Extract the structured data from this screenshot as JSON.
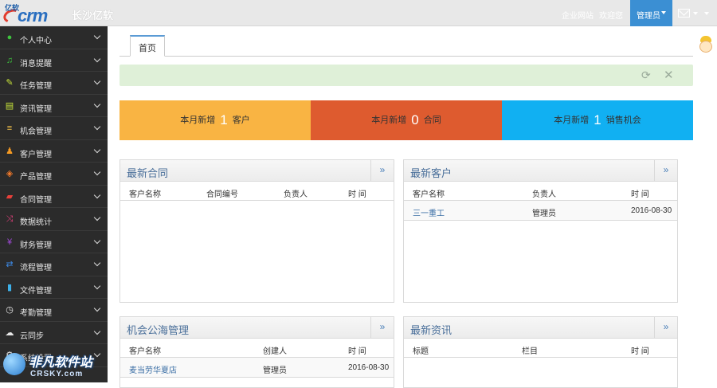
{
  "header": {
    "logo_prefix": "亿软",
    "logo_text": "crm",
    "brand": "长沙亿软",
    "links": [
      "企业网站",
      "欢迎您"
    ],
    "user": "管理员"
  },
  "sidebar": {
    "items": [
      {
        "label": "个人中心",
        "icon": "user-icon",
        "color": "#3ec43e"
      },
      {
        "label": "消息提醒",
        "icon": "bell-icon",
        "color": "#3ec43e"
      },
      {
        "label": "任务管理",
        "icon": "edit-icon",
        "color": "#c6e23a"
      },
      {
        "label": "资讯管理",
        "icon": "document-icon",
        "color": "#c6e23a"
      },
      {
        "label": "机会管理",
        "icon": "list-icon",
        "color": "#f2c14a"
      },
      {
        "label": "客户管理",
        "icon": "users-icon",
        "color": "#f59a23"
      },
      {
        "label": "产品管理",
        "icon": "dropbox-icon",
        "color": "#f47a2a"
      },
      {
        "label": "合同管理",
        "icon": "folder-icon",
        "color": "#e8403a"
      },
      {
        "label": "数据统计",
        "icon": "shuffle-icon",
        "color": "#e0407a"
      },
      {
        "label": "财务管理",
        "icon": "yen-icon",
        "color": "#a04ad8"
      },
      {
        "label": "流程管理",
        "icon": "retweet-icon",
        "color": "#3d8be8"
      },
      {
        "label": "文件管理",
        "icon": "file-icon",
        "color": "#3db0e8"
      },
      {
        "label": "考勤管理",
        "icon": "clock-icon",
        "color": "#e6e6e6"
      },
      {
        "label": "云同步",
        "icon": "cloud-upload-icon",
        "color": "#e6e6e6"
      },
      {
        "label": "系统设置",
        "icon": "gear-icon",
        "color": "#e6e6e6"
      }
    ]
  },
  "tabs": [
    "首页"
  ],
  "stats": [
    {
      "prefix": "本月新增",
      "value": "1",
      "suffix": "客户",
      "color": "#f9b443"
    },
    {
      "prefix": "本月新增",
      "value": "0",
      "suffix": "合同",
      "color": "#de5b2f"
    },
    {
      "prefix": "本月新增",
      "value": "1",
      "suffix": "销售机会",
      "color": "#11b0f2"
    }
  ],
  "panels": {
    "contracts": {
      "title": "最新合同",
      "more": "»",
      "columns": [
        "客户名称",
        "合同编号",
        "负责人",
        "时 间"
      ],
      "rows": []
    },
    "customers": {
      "title": "最新客户",
      "more": "»",
      "columns": [
        "客户名称",
        "负责人",
        "时 间"
      ],
      "rows": [
        [
          "三一重工",
          "管理员",
          "2016-08-30"
        ]
      ]
    },
    "opportunities": {
      "title": "机会公海管理",
      "more": "»",
      "columns": [
        "客户名称",
        "创建人",
        "时 间"
      ],
      "rows": [
        [
          "麦当劳华夏店",
          "管理员",
          "2016-08-30"
        ]
      ]
    },
    "news": {
      "title": "最新资讯",
      "more": "»",
      "columns": [
        "标题",
        "栏目",
        "时 间"
      ],
      "rows": []
    }
  },
  "watermark": {
    "big": "非凡软件站",
    "small": "CRSKY.com"
  }
}
